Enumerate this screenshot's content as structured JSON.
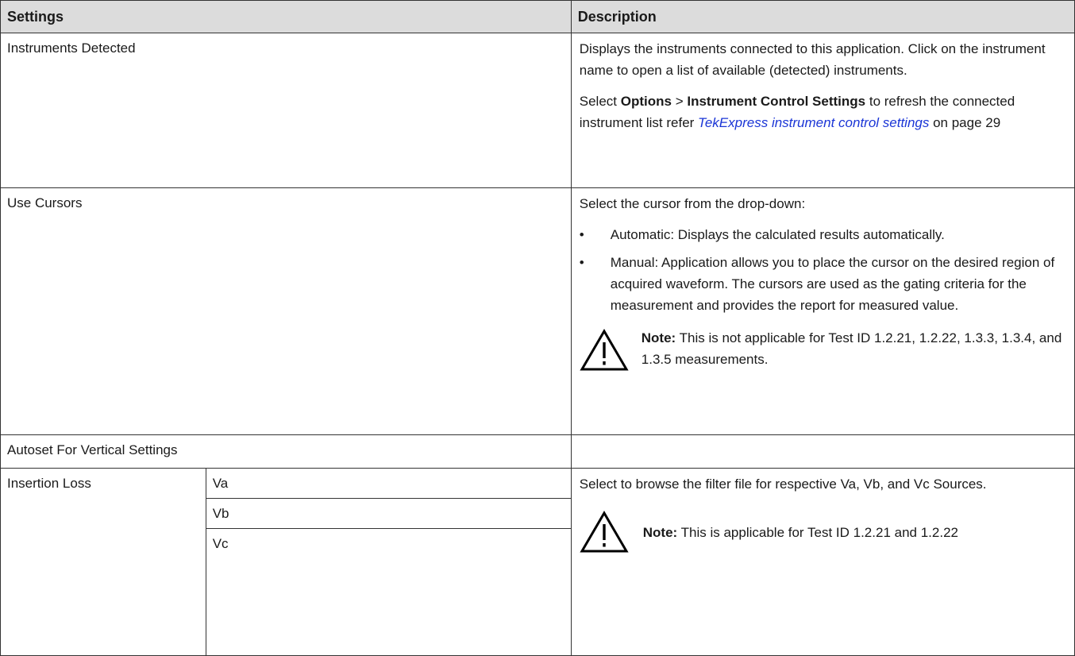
{
  "headers": {
    "settings": "Settings",
    "description": "Description"
  },
  "rows": {
    "instruments": {
      "label": "Instruments Detected",
      "p1": "Displays the instruments connected to this application. Click on the instrument name to open a list of available (detected) instruments.",
      "p2_prefix": "Select ",
      "p2_options": "Options",
      "p2_sep": " > ",
      "p2_ics": "Instrument Control Settings",
      "p2_mid": " to refresh the connected instrument list refer ",
      "p2_link": "TekExpress instrument control settings",
      "p2_suffix": " on page 29"
    },
    "cursors": {
      "label": "Use Cursors",
      "intro": "Select the cursor from the drop-down:",
      "bullets": [
        "Automatic: Displays the calculated results automatically.",
        "Manual: Application allows you to place the cursor on the desired region of acquired waveform. The cursors are used as the gating criteria for the measurement and provides the report for measured value."
      ],
      "note_label": "Note:",
      "note_text": " This is not applicable for Test ID 1.2.21, 1.2.22, 1.3.3, 1.3.4, and 1.3.5 measurements."
    },
    "autoset": {
      "label": "Autoset For Vertical Settings"
    },
    "insertion": {
      "label": "Insertion Loss",
      "sources": [
        "Va",
        "Vb",
        "Vc"
      ],
      "desc": "Select to browse the filter file for respective Va, Vb, and Vc Sources.",
      "note_label": "Note:",
      "note_text": " This is applicable for Test ID 1.2.21 and 1.2.22"
    }
  },
  "icons": {
    "warning": "warning-triangle-icon"
  }
}
